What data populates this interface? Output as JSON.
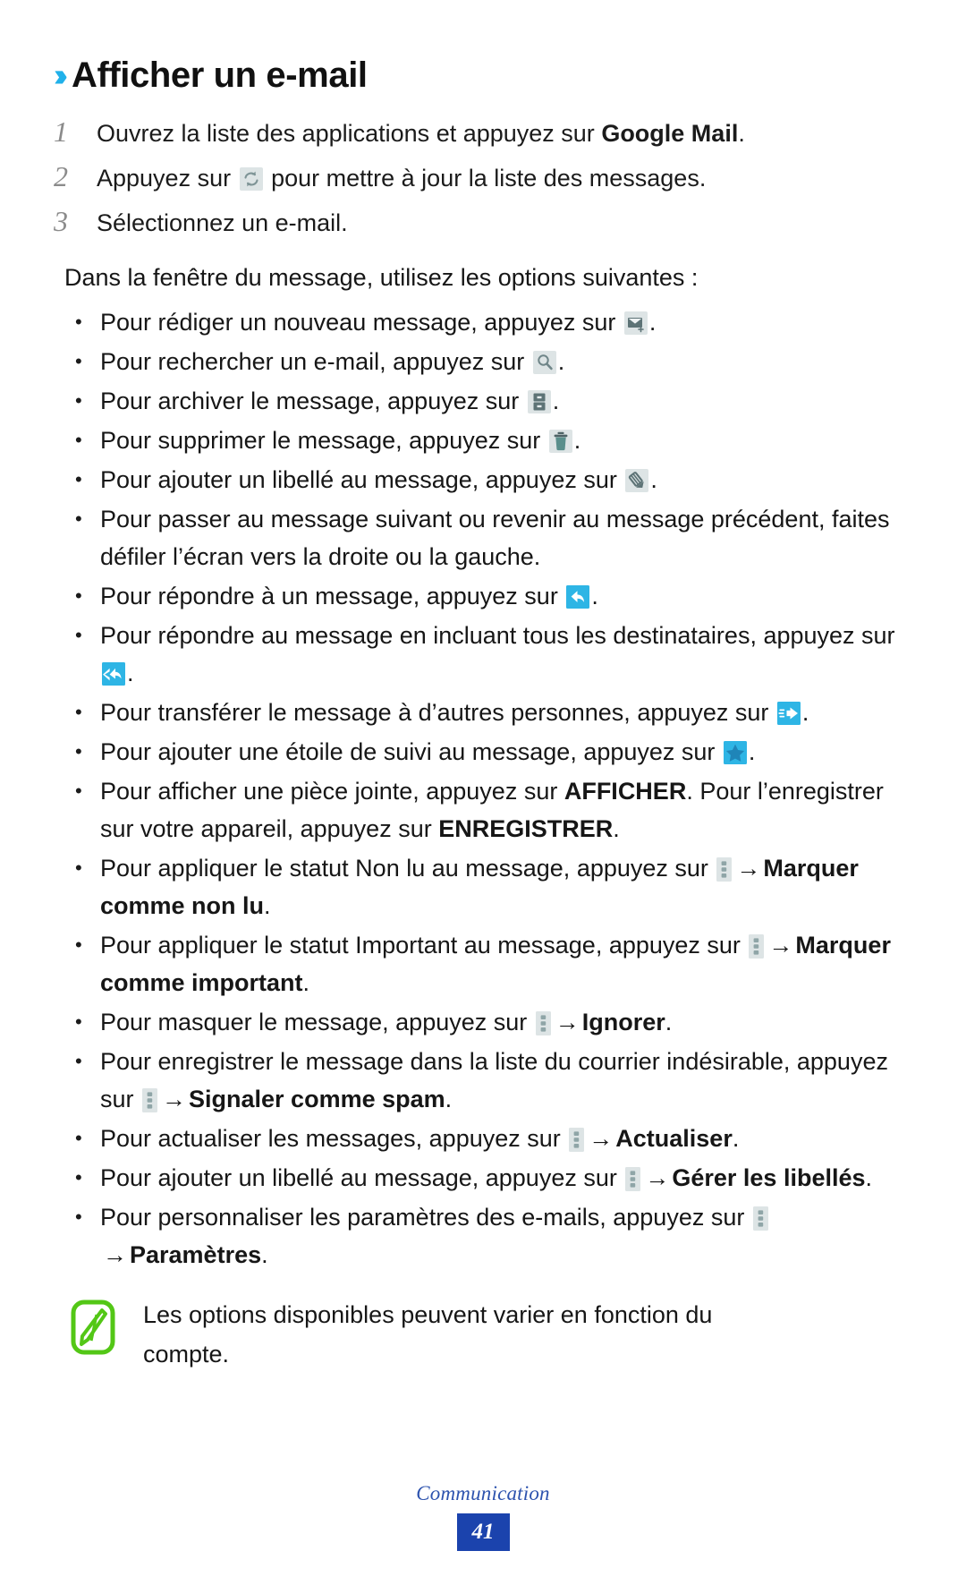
{
  "heading": {
    "chevron": "››",
    "title": "Afficher un e-mail"
  },
  "steps": [
    {
      "num": "1",
      "text_before": "Ouvrez la liste des applications et appuyez sur ",
      "bold": "Google Mail",
      "text_after": "."
    },
    {
      "num": "2",
      "text_before": "Appuyez sur ",
      "icon": "refresh-icon",
      "text_after": " pour mettre à jour la liste des messages."
    },
    {
      "num": "3",
      "text_before": "Sélectionnez un e-mail.",
      "icon": null,
      "text_after": ""
    }
  ],
  "intro": "Dans la fenêtre du message, utilisez les options suivantes :",
  "bullets": [
    {
      "id": "compose",
      "before": "Pour rédiger un nouveau message, appuyez sur ",
      "icon": "compose-icon",
      "after": "."
    },
    {
      "id": "search",
      "before": "Pour rechercher un e-mail, appuyez sur ",
      "icon": "search-icon",
      "after": "."
    },
    {
      "id": "archive",
      "before": "Pour archiver le message, appuyez sur ",
      "icon": "archive-icon",
      "after": "."
    },
    {
      "id": "delete",
      "before": "Pour supprimer le message, appuyez sur ",
      "icon": "trash-icon",
      "after": "."
    },
    {
      "id": "add-label",
      "before": "Pour ajouter un libellé au message, appuyez sur ",
      "icon": "label-icon",
      "after": "."
    },
    {
      "id": "navigate",
      "before": "Pour passer au message suivant ou revenir au message précédent, faites défiler l’écran vers la droite ou la gauche.",
      "icon": null,
      "after": ""
    },
    {
      "id": "reply",
      "before": "Pour répondre à un message, appuyez sur ",
      "icon": "reply-icon",
      "after": "."
    },
    {
      "id": "reply-all",
      "before": "Pour répondre au message en incluant tous les destinataires, appuyez sur ",
      "icon": "reply-all-icon",
      "after": "."
    },
    {
      "id": "forward",
      "before": "Pour transférer le message à d’autres personnes, appuyez sur ",
      "icon": "forward-icon",
      "after": "."
    },
    {
      "id": "star",
      "before": "Pour ajouter une étoile de suivi au message, appuyez sur ",
      "icon": "star-icon",
      "after": "."
    },
    {
      "id": "attachment",
      "before": "Pour afficher une pièce jointe, appuyez sur ",
      "bold1": "AFFICHER",
      "mid": ". Pour l’enregistrer sur votre appareil, appuyez sur ",
      "bold2": "ENREGISTRER",
      "after": "."
    },
    {
      "id": "mark-unread",
      "before": "Pour appliquer le statut Non lu au message, appuyez sur ",
      "icon": "menu-icon",
      "arrow": "→",
      "bold": "Marquer comme non lu",
      "after": "."
    },
    {
      "id": "mark-important",
      "before": "Pour appliquer le statut Important au message, appuyez sur ",
      "icon": "menu-icon",
      "arrow": "→",
      "bold": "Marquer comme important",
      "after": "."
    },
    {
      "id": "mute",
      "before": "Pour masquer le message, appuyez sur ",
      "icon": "menu-icon",
      "arrow": "→",
      "bold": "Ignorer",
      "after": "."
    },
    {
      "id": "spam",
      "before": "Pour enregistrer le message dans la liste du courrier indésirable, appuyez sur ",
      "icon": "menu-icon",
      "arrow": "→",
      "bold": "Signaler comme spam",
      "after": "."
    },
    {
      "id": "refresh",
      "before": "Pour actualiser les messages, appuyez sur ",
      "icon": "menu-icon",
      "arrow": "→",
      "bold": "Actualiser",
      "after": "."
    },
    {
      "id": "manage-labels",
      "before": "Pour ajouter un libellé au message, appuyez sur ",
      "icon": "menu-icon",
      "arrow": "→",
      "bold": "Gérer les libellés",
      "after": "."
    },
    {
      "id": "settings",
      "before": "Pour personnaliser les paramètres des e-mails, appuyez sur ",
      "icon": "menu-icon",
      "arrow": "→",
      "bold": "Paramètres",
      "after": "."
    }
  ],
  "note": {
    "icon": "note-pen-icon",
    "text": "Les options disponibles peuvent varier en fonction du compte."
  },
  "footer": {
    "chapter": "Communication",
    "page": "41"
  },
  "colors": {
    "chevron_blue": "#21b1ea",
    "icon_cyan": "#2eb5e5",
    "icon_chip_gray": "#dde4e5",
    "icon_dark": "#4b6063",
    "note_green": "#53c716",
    "footer_blue": "#1b43ad",
    "step_number_gray": "#8b8b8b"
  }
}
